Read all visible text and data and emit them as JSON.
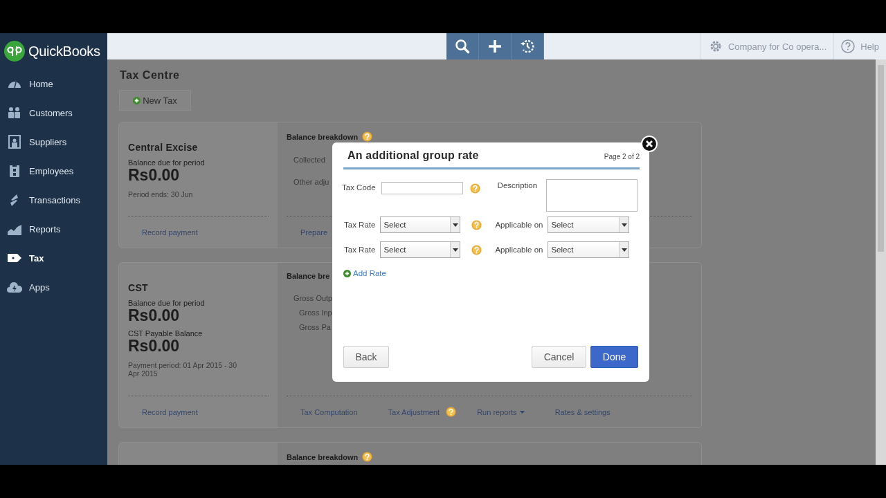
{
  "app": {
    "logo": "QuickBooks"
  },
  "sidebar": {
    "items": [
      {
        "label": "Home",
        "selected": false
      },
      {
        "label": "Customers",
        "selected": false
      },
      {
        "label": "Suppliers",
        "selected": false
      },
      {
        "label": "Employees",
        "selected": false
      },
      {
        "label": "Transactions",
        "selected": false
      },
      {
        "label": "Reports",
        "selected": false
      },
      {
        "label": "Tax",
        "selected": true
      },
      {
        "label": "Apps",
        "selected": false
      }
    ]
  },
  "topbar": {
    "company": "Company for Co opera...",
    "help": "Help"
  },
  "page": {
    "title": "Tax Centre",
    "new_button": "New Tax"
  },
  "tax_cards": [
    {
      "name": "Central Excise",
      "figures": [
        {
          "label": "Balance due for period",
          "amount": "Rs0.00"
        }
      ],
      "note": "Period ends: 30 Jun",
      "action": "Record payment",
      "breakdown_title": "Balance breakdown",
      "breakdown_help": true,
      "breakdown_items": [
        "Collected",
        "Other adju"
      ],
      "links": [
        {
          "label": "Prepare",
          "kind": "link"
        }
      ]
    },
    {
      "name": "CST",
      "figures": [
        {
          "label": "Balance due for period",
          "amount": "Rs0.00"
        },
        {
          "label": "CST Payable Balance",
          "amount": "Rs0.00"
        }
      ],
      "note": "Payment period: 01 Apr 2015 - 30 Apr 2015",
      "action": "Record payment",
      "breakdown_title": "Balance bre",
      "breakdown_items": [
        "Gross Outp",
        "Gross Inp",
        "Gross Pa"
      ],
      "links": [
        {
          "label": "Tax Computation",
          "kind": "link"
        },
        {
          "label": "Tax Adjustment",
          "kind": "link"
        },
        {
          "kind": "help"
        },
        {
          "label": "Run reports",
          "kind": "menu"
        },
        {
          "label": "Rates & settings",
          "kind": "link"
        }
      ]
    },
    {
      "breakdown_title": "Balance breakdown",
      "breakdown_help": true
    }
  ],
  "dialog": {
    "title": "An additional group rate",
    "page": "Page 2 of 2",
    "tax_code_label": "Tax Code",
    "description_label": "Description",
    "rate_rows": [
      {
        "label": "Tax Rate",
        "value": "Select",
        "applies_label": "Applicable on",
        "applies_value": "Select"
      },
      {
        "label": "Tax Rate",
        "value": "Select",
        "applies_label": "Applicable on",
        "applies_value": "Select"
      }
    ],
    "add_rate": "Add Rate",
    "back": "Back",
    "cancel": "Cancel",
    "done": "Done"
  }
}
